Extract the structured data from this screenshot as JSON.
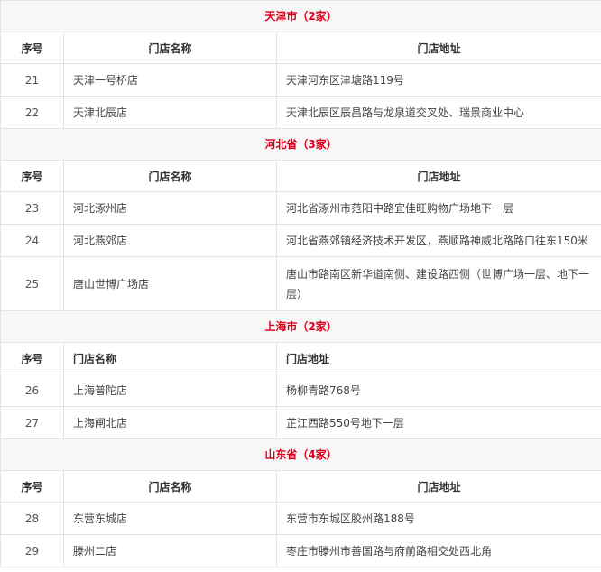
{
  "sections": [
    {
      "title": "天津市（2家）",
      "headers": [
        "序号",
        "门店名称",
        "门店地址"
      ],
      "header_align": "center",
      "rows": [
        {
          "num": "21",
          "name": "天津一号桥店",
          "addr": "天津河东区津塘路119号"
        },
        {
          "num": "22",
          "name": "天津北辰店",
          "addr": "天津北辰区辰昌路与龙泉道交叉处、瑞景商业中心"
        }
      ]
    },
    {
      "title": "河北省（3家）",
      "headers": [
        "序号",
        "门店名称",
        "门店地址"
      ],
      "header_align": "center",
      "rows": [
        {
          "num": "23",
          "name": "河北涿州店",
          "addr": "河北省涿州市范阳中路宜佳旺购物广场地下一层"
        },
        {
          "num": "24",
          "name": "河北燕郊店",
          "addr": "河北省燕郊镇经济技术开发区，燕顺路神威北路路口往东150米"
        },
        {
          "num": "25",
          "name": "唐山世博广场店",
          "addr": "唐山市路南区新华道南侧、建设路西侧（世博广场一层、地下一层）"
        }
      ]
    },
    {
      "title": "上海市（2家）",
      "headers": [
        "序号",
        "门店名称",
        "门店地址"
      ],
      "header_align": "left",
      "rows": [
        {
          "num": "26",
          "name": "上海普陀店",
          "addr": "杨柳青路768号"
        },
        {
          "num": "27",
          "name": "上海闸北店",
          "addr": "芷江西路550号地下一层"
        }
      ]
    },
    {
      "title": "山东省（4家）",
      "headers": [
        "序号",
        "门店名称",
        "门店地址"
      ],
      "header_align": "center",
      "rows": [
        {
          "num": "28",
          "name": "东营东城店",
          "addr": "东营市东城区胶州路188号"
        },
        {
          "num": "29",
          "name": "滕州二店",
          "addr": "枣庄市滕州市善国路与府前路相交处西北角"
        }
      ]
    }
  ]
}
